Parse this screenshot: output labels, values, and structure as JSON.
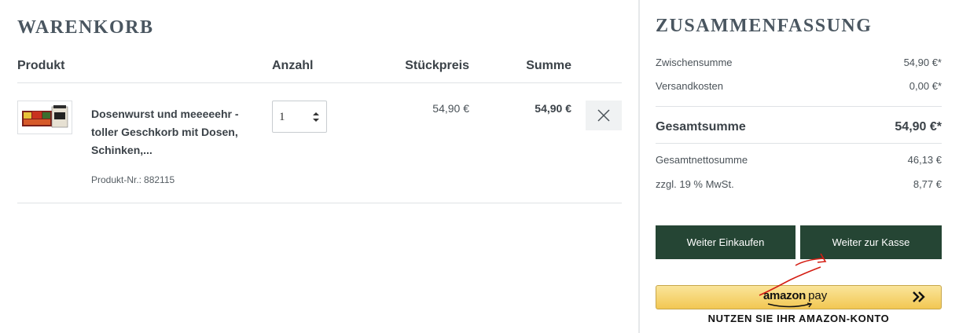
{
  "cart": {
    "title": "WARENKORB",
    "columns": {
      "product": "Produkt",
      "quantity": "Anzahl",
      "unit_price": "Stückpreis",
      "total": "Summe"
    },
    "items": [
      {
        "name": "Dosenwurst und meeeeehr - toller Geschkorb mit Dosen, Schinken,...",
        "product_nr_label": "Produkt-Nr.:",
        "product_nr": "882115",
        "quantity": "1",
        "unit_price": "54,90 €",
        "total": "54,90 €",
        "remove_icon": "close-icon"
      }
    ]
  },
  "summary": {
    "title": "ZUSAMMENFASSUNG",
    "subtotal_label": "Zwischensumme",
    "subtotal_value": "54,90 €*",
    "shipping_label": "Versandkosten",
    "shipping_value": "0,00 €*",
    "grand_total_label": "Gesamtsumme",
    "grand_total_value": "54,90 €*",
    "net_total_label": "Gesamtnettosumme",
    "net_total_value": "46,13 €",
    "vat_label": "zzgl. 19 % MwSt.",
    "vat_value": "8,77 €",
    "continue_label": "Weiter Einkaufen",
    "checkout_label": "Weiter zur Kasse",
    "amazon_pay": {
      "brand": "amazon",
      "product": "pay",
      "caption": "NUTZEN SIE IHR AMAZON-KONTO"
    }
  },
  "colors": {
    "button_bg": "#254534",
    "amazon_yellow": "#f2c753",
    "annotation_red": "#d41d12"
  }
}
